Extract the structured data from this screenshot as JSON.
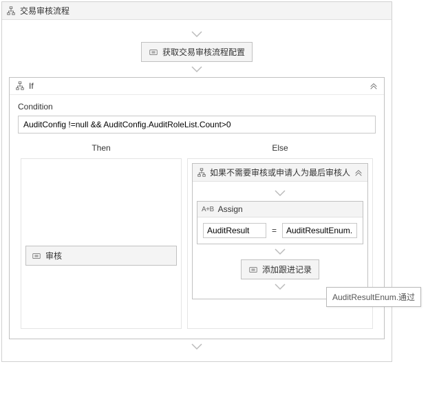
{
  "workflow": {
    "title": "交易审核流程",
    "get_config_activity": "获取交易审核流程配置"
  },
  "if_block": {
    "title": "If",
    "condition_label": "Condition",
    "condition_value": "AuditConfig !=null && AuditConfig.AuditRoleList.Count>0",
    "then_label": "Then",
    "else_label": "Else"
  },
  "then_branch": {
    "audit_activity": "审核"
  },
  "else_branch": {
    "sequence_title": "如果不需要审核或申请人为最后审核人",
    "assign": {
      "header": "Assign",
      "badge": "A+B",
      "to": "AuditResult",
      "eq": "=",
      "value": "AuditResultEnum.通过",
      "value_display": "AuditResultEnum."
    },
    "add_track_activity": "添加跟进记录"
  },
  "tooltip": "AuditResultEnum.通过"
}
